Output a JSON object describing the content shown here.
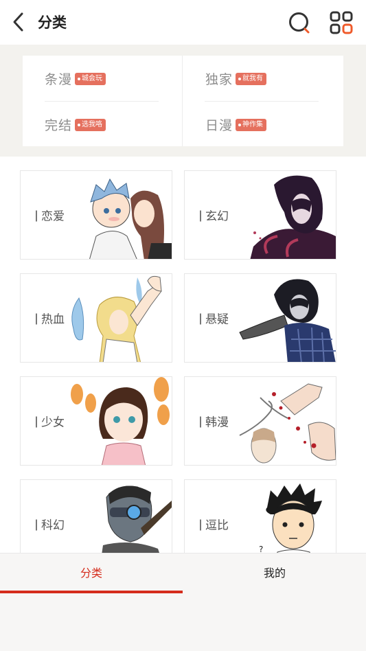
{
  "header": {
    "title": "分类"
  },
  "featured": [
    {
      "label": "条漫",
      "tag": "城会玩"
    },
    {
      "label": "独家",
      "tag": "就我有"
    },
    {
      "label": "完结",
      "tag": "选我咯"
    },
    {
      "label": "日漫",
      "tag": "神作集"
    }
  ],
  "categories": [
    {
      "label": "恋爱"
    },
    {
      "label": "玄幻"
    },
    {
      "label": "热血"
    },
    {
      "label": "悬疑"
    },
    {
      "label": "少女"
    },
    {
      "label": "韩漫"
    },
    {
      "label": "科幻"
    },
    {
      "label": "逗比"
    }
  ],
  "tabs": {
    "category": "分类",
    "mine": "我的"
  },
  "colors": {
    "accent": "#d52c1c",
    "tag_bg": "#e5705e",
    "featured_bg": "#f3f2ee"
  },
  "icons": [
    "back-arrow-icon",
    "search-icon",
    "grid-menu-icon"
  ]
}
